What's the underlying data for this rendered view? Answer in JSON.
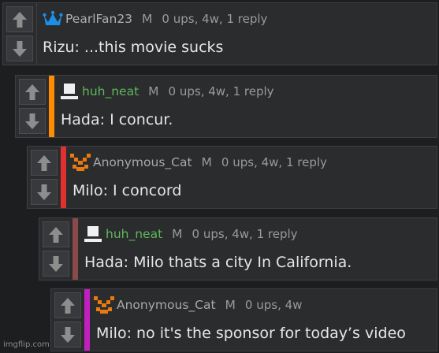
{
  "comments": [
    {
      "username": "PearlFan23",
      "username_color": "#b0b0b0",
      "avatar_icon": "blue-crown-icon",
      "mod_badge": "M",
      "stats": "0 ups, 4w, 1 reply",
      "text": "Rizu: ...this movie sucks",
      "bar_color": null
    },
    {
      "username": "huh_neat",
      "username_color": "#5fb85a",
      "avatar_icon": "white-computer-icon",
      "mod_badge": "M",
      "stats": "0 ups, 4w, 1 reply",
      "text": "Hada: I concur.",
      "bar_color": "#ff8c00"
    },
    {
      "username": "Anonymous_Cat",
      "username_color": "#a8a8a8",
      "avatar_icon": "orange-pixel-cat-icon",
      "mod_badge": "M",
      "stats": "0 ups, 4w, 1 reply",
      "text": "Milo: I concord",
      "bar_color": "#e03030"
    },
    {
      "username": "huh_neat",
      "username_color": "#5fb85a",
      "avatar_icon": "white-computer-icon",
      "mod_badge": "M",
      "stats": "0 ups, 4w, 1 reply",
      "text": "Hada: Milo thats a city In California.",
      "bar_color": "#8b4a4a"
    },
    {
      "username": "Anonymous_Cat",
      "username_color": "#a8a8a8",
      "avatar_icon": "orange-pixel-cat-icon",
      "mod_badge": "M",
      "stats": "0 ups, 4w",
      "text": "Milo: no it's the sponsor for today’s video",
      "bar_color": "#c020c0"
    }
  ],
  "watermark": "imgflip.com"
}
